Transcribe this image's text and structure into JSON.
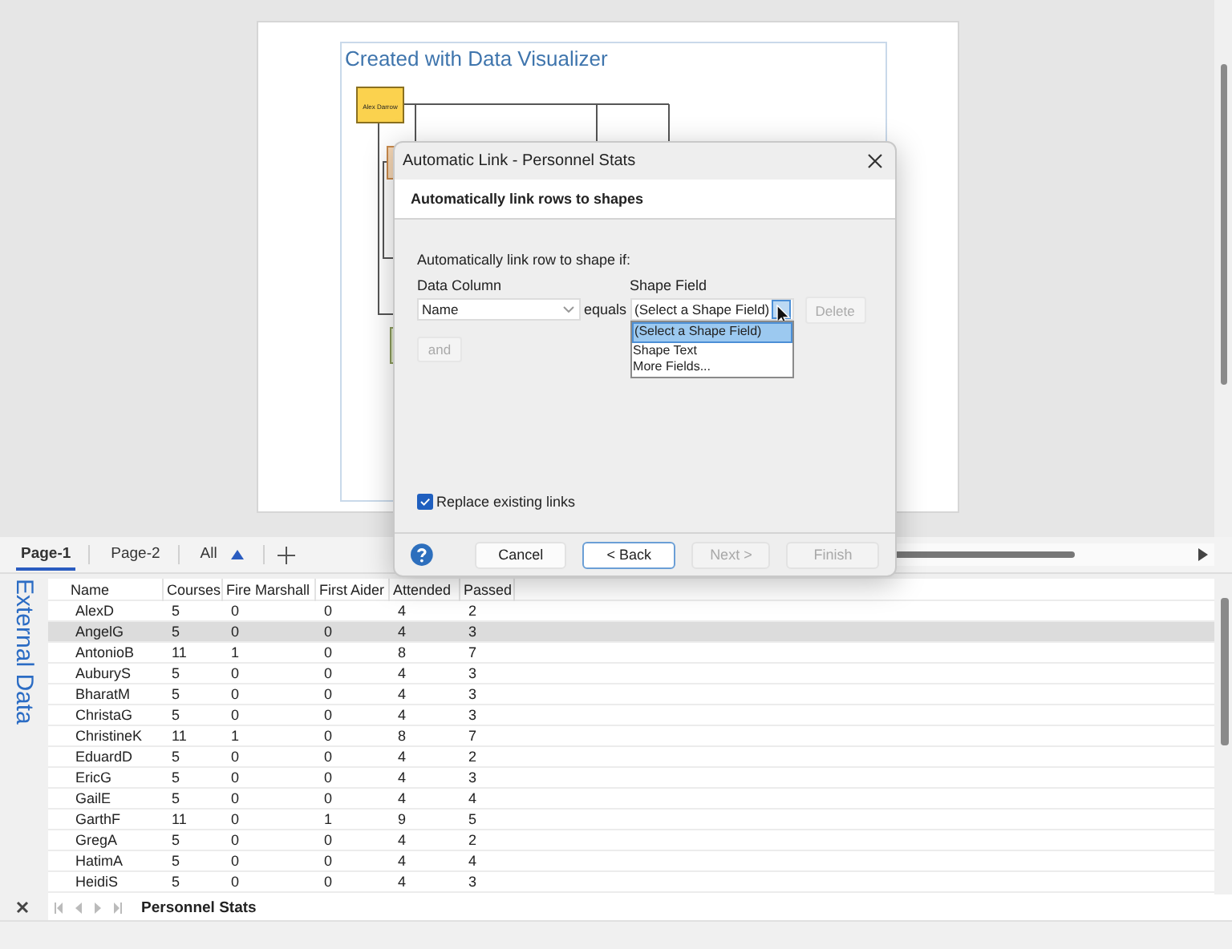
{
  "canvas": {
    "title": "Created with Data Visualizer",
    "shape_label": "Alex Darrow"
  },
  "page_tabs": [
    {
      "label": "Page-1",
      "selected": true
    },
    {
      "label": "Page-2",
      "selected": false
    }
  ],
  "page_filter": {
    "label": "All"
  },
  "external_data": {
    "title": "External Data",
    "columns": [
      "Name",
      "Courses",
      "Fire Marshall",
      "First Aider",
      "Attended",
      "Passed"
    ],
    "rows": [
      {
        "cells": [
          "AlexD",
          "5",
          "0",
          "0",
          "4",
          "2"
        ],
        "selected": false
      },
      {
        "cells": [
          "AngelG",
          "5",
          "0",
          "0",
          "4",
          "3"
        ],
        "selected": true
      },
      {
        "cells": [
          "AntonioB",
          "11",
          "1",
          "0",
          "8",
          "7"
        ],
        "selected": false
      },
      {
        "cells": [
          "AuburyS",
          "5",
          "0",
          "0",
          "4",
          "3"
        ],
        "selected": false
      },
      {
        "cells": [
          "BharatM",
          "5",
          "0",
          "0",
          "4",
          "3"
        ],
        "selected": false
      },
      {
        "cells": [
          "ChristaG",
          "5",
          "0",
          "0",
          "4",
          "3"
        ],
        "selected": false
      },
      {
        "cells": [
          "ChristineK",
          "11",
          "1",
          "0",
          "8",
          "7"
        ],
        "selected": false
      },
      {
        "cells": [
          "EduardD",
          "5",
          "0",
          "0",
          "4",
          "2"
        ],
        "selected": false
      },
      {
        "cells": [
          "EricG",
          "5",
          "0",
          "0",
          "4",
          "3"
        ],
        "selected": false
      },
      {
        "cells": [
          "GailE",
          "5",
          "0",
          "0",
          "4",
          "4"
        ],
        "selected": false
      },
      {
        "cells": [
          "GarthF",
          "11",
          "0",
          "1",
          "9",
          "5"
        ],
        "selected": false
      },
      {
        "cells": [
          "GregA",
          "5",
          "0",
          "0",
          "4",
          "2"
        ],
        "selected": false
      },
      {
        "cells": [
          "HatimA",
          "5",
          "0",
          "0",
          "4",
          "4"
        ],
        "selected": false
      },
      {
        "cells": [
          "HeidiS",
          "5",
          "0",
          "0",
          "4",
          "3"
        ],
        "selected": false
      }
    ],
    "sheet_tab": "Personnel Stats"
  },
  "dialog": {
    "title": "Automatic Link - Personnel Stats",
    "heading": "Automatically link rows to shapes",
    "instruction": "Automatically link row to shape if:",
    "data_column": {
      "label": "Data Column",
      "value": "Name"
    },
    "operator": "equals",
    "shape_field": {
      "label": "Shape Field",
      "value": "(Select a Shape Field)",
      "expanded": true,
      "options": [
        {
          "label": "(Select a Shape Field)",
          "selected": true
        },
        {
          "label": "Shape Text",
          "selected": false
        },
        {
          "label": "More Fields...",
          "selected": false
        }
      ]
    },
    "delete_button": {
      "label": "Delete",
      "disabled": true
    },
    "and_button": {
      "label": "and",
      "disabled": true
    },
    "replace_links": {
      "label": "Replace existing links",
      "checked": true
    },
    "buttons": [
      {
        "label": "Cancel",
        "disabled": false,
        "focused": false
      },
      {
        "label": "< Back",
        "disabled": false,
        "focused": true
      },
      {
        "label": "Next >",
        "disabled": true,
        "focused": false
      },
      {
        "label": "Finish",
        "disabled": true,
        "focused": false
      }
    ]
  }
}
